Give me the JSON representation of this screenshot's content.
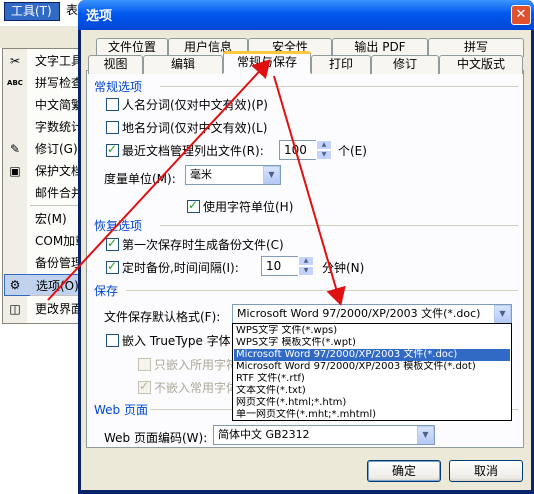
{
  "menu": {
    "bar_label": "工具(T)",
    "bar_label2": "表",
    "items": [
      {
        "label": "文字工具",
        "icon": "text-tools-icon",
        "glyph": "✂"
      },
      {
        "label": "拼写检查",
        "icon": "spellcheck-icon",
        "glyph": "ABC"
      },
      {
        "label": "中文简繁",
        "icon": "",
        "glyph": ""
      },
      {
        "label": "字数统计",
        "icon": "",
        "glyph": ""
      },
      {
        "label": "修订(G)",
        "icon": "revision-icon",
        "glyph": "✎"
      },
      {
        "label": "保护文档",
        "icon": "protect-doc-icon",
        "glyph": "▣"
      },
      {
        "label": "邮件合并",
        "icon": "",
        "glyph": ""
      },
      {
        "label": "宏(M)",
        "icon": "",
        "glyph": ""
      },
      {
        "label": "COM加载项",
        "icon": "",
        "glyph": ""
      },
      {
        "label": "备份管理",
        "icon": "",
        "glyph": ""
      },
      {
        "label": "选项(O)",
        "icon": "options-gear-icon",
        "glyph": "⚙"
      },
      {
        "label": "更改界面",
        "icon": "change-ui-icon",
        "glyph": "◫"
      }
    ]
  },
  "dialog": {
    "title": "选项",
    "close_glyph": "✕",
    "tabs_row1": [
      "文件位置",
      "用户信息",
      "安全性",
      "输出 PDF",
      "拼写"
    ],
    "tabs_row2": [
      "视图",
      "编辑",
      "常规与保存",
      "打印",
      "修订",
      "中文版式"
    ],
    "active_tab": "常规与保存",
    "general": {
      "header": "常规选项",
      "name_split": "人名分词(仅对中文有效)(P)",
      "place_split": "地名分词(仅对中文有效)(L)",
      "recent_files": "最近文档管理列出文件(R):",
      "recent_count": "100",
      "recent_unit": "个(E)",
      "measure_label": "度量单位(M):",
      "measure_value": "毫米",
      "char_unit": "使用字符单位(H)"
    },
    "recovery": {
      "header": "恢复选项",
      "backup_first_save": "第一次保存时生成备份文件(C)",
      "auto_backup": "定时备份,时间间隔(I):",
      "interval": "10",
      "interval_unit": "分钟(N)"
    },
    "save": {
      "header": "保存",
      "default_format_label": "文件保存默认格式(F):",
      "default_format_value": "Microsoft Word 97/2000/XP/2003 文件(*.doc)",
      "embed_truetype": "嵌入 TrueType 字体",
      "embed_used_only": "只嵌入所用字符",
      "no_common_fonts": "不嵌入常用字体",
      "format_options": [
        "WPS文字 文件(*.wps)",
        "WPS文字 模板文件(*.wpt)",
        "Microsoft Word 97/2000/XP/2003 文件(*.doc)",
        "Microsoft Word 97/2000/XP/2003 模板文件(*.dot)",
        "RTF 文件(*.rtf)",
        "文本文件(*.txt)",
        "网页文件(*.html;*.htm)",
        "单一网页文件(*.mht;*.mhtml)"
      ],
      "selected_index": 2
    },
    "web": {
      "header": "Web 页面",
      "encoding_label": "Web 页面编码(W):",
      "encoding_value": "简体中文 GB2312"
    },
    "ok": "确定",
    "cancel": "取消"
  },
  "colors": {
    "title_bar": "#0058ee",
    "group_header": "#0046d5",
    "annotation_arrow": "#e01010",
    "selection": "#316ac5"
  }
}
